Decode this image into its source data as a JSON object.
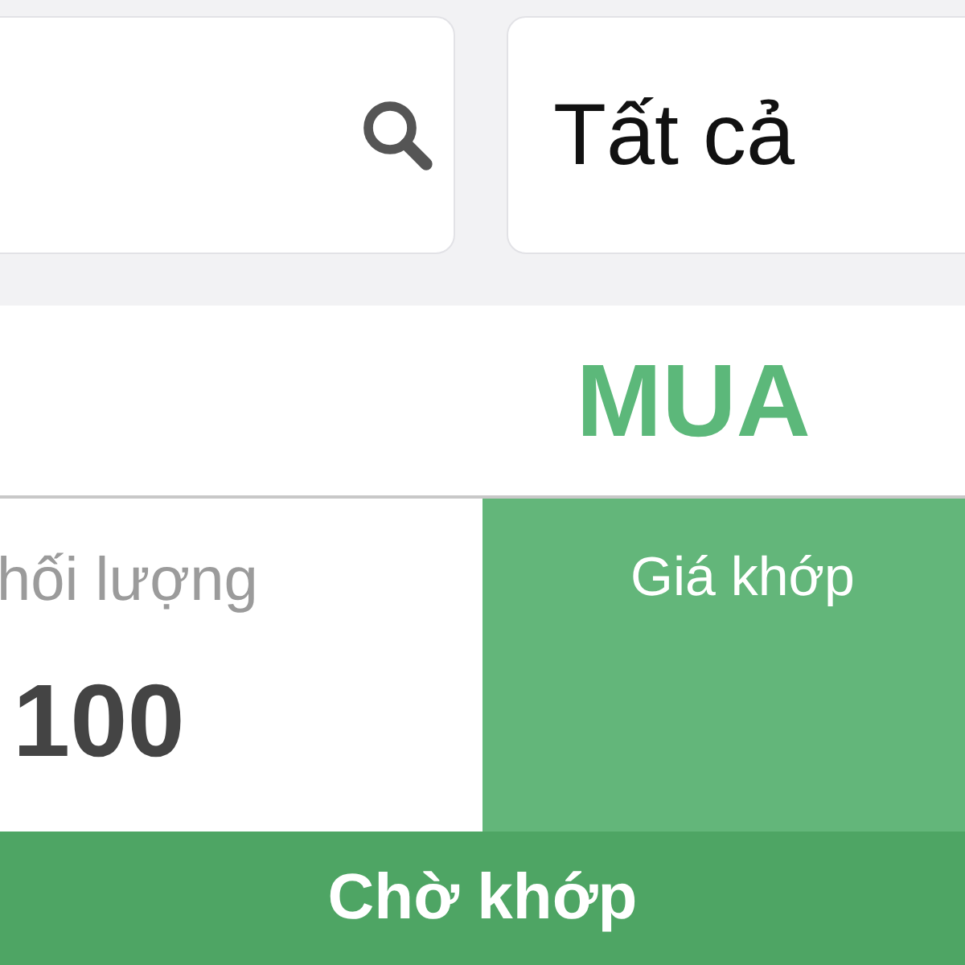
{
  "filters": {
    "status_dropdown": {
      "value": "Tất cả"
    }
  },
  "side": "MUA",
  "order": {
    "volume_label": "hối lượng",
    "volume": "100",
    "price_label": "Giá khớp"
  },
  "status": "Chờ khớp"
}
